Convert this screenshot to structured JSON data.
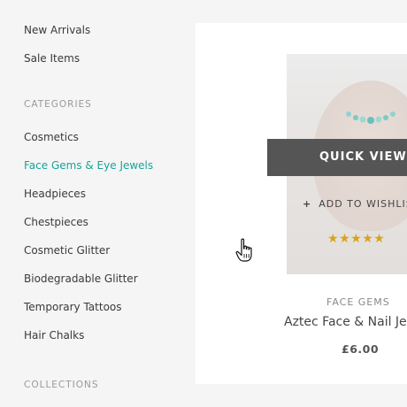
{
  "sidebar": {
    "top_links": [
      "New Arrivals",
      "Sale Items"
    ],
    "categories_heading": "CATEGORIES",
    "categories": [
      {
        "label": "Cosmetics",
        "active": false
      },
      {
        "label": "Face Gems & Eye Jewels",
        "active": true
      },
      {
        "label": "Headpieces",
        "active": false
      },
      {
        "label": "Chestpieces",
        "active": false
      },
      {
        "label": "Cosmetic Glitter",
        "active": false
      },
      {
        "label": "Biodegradable Glitter",
        "active": false
      },
      {
        "label": "Temporary Tattoos",
        "active": false
      },
      {
        "label": "Hair Chalks",
        "active": false
      }
    ],
    "collections_heading": "COLLECTIONS"
  },
  "product": {
    "quick_view_label": "QUICK VIEW",
    "wishlist_label": "ADD TO WISHLIS",
    "rating": 5,
    "rating_max": 5,
    "category": "FACE GEMS",
    "name": "Aztec Face & Nail Jev",
    "price": "£6.00"
  },
  "colors": {
    "accent": "#1aa39a",
    "star": "#d9a21b",
    "quick_view_bg": "#555555"
  },
  "icons": {
    "wishlist": "plus-icon",
    "cursor": "hand-pointer-icon"
  }
}
